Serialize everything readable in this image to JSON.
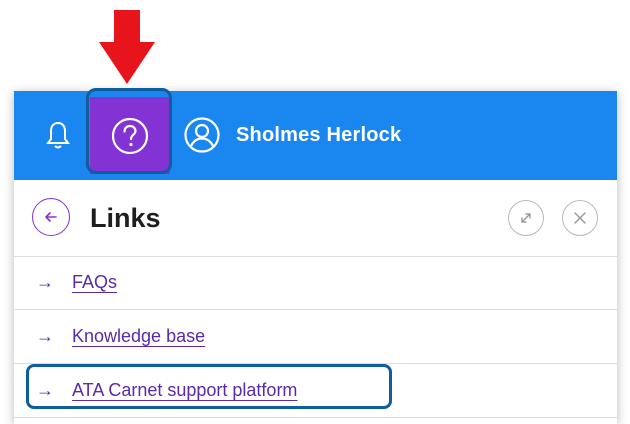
{
  "header_bar": {
    "username": "Sholmes Herlock",
    "icons": {
      "notifications": "bell-icon",
      "help": "help-circle-icon",
      "user": "user-circle-icon"
    }
  },
  "panel": {
    "title": "Links",
    "back_icon": "arrow-left-circle-icon",
    "expand_icon": "expand-icon",
    "close_icon": "close-icon"
  },
  "links": [
    {
      "arrow": "→",
      "label": "FAQs"
    },
    {
      "arrow": "→",
      "label": "Knowledge base"
    },
    {
      "arrow": "→",
      "label": "ATA Carnet support platform"
    }
  ],
  "colors": {
    "header_bg": "#1a87f0",
    "help_active_bg": "#8333d4",
    "link": "#5a2aa8",
    "annotation_arrow": "#e8141b",
    "annotation_outline": "#0f5c9f"
  }
}
